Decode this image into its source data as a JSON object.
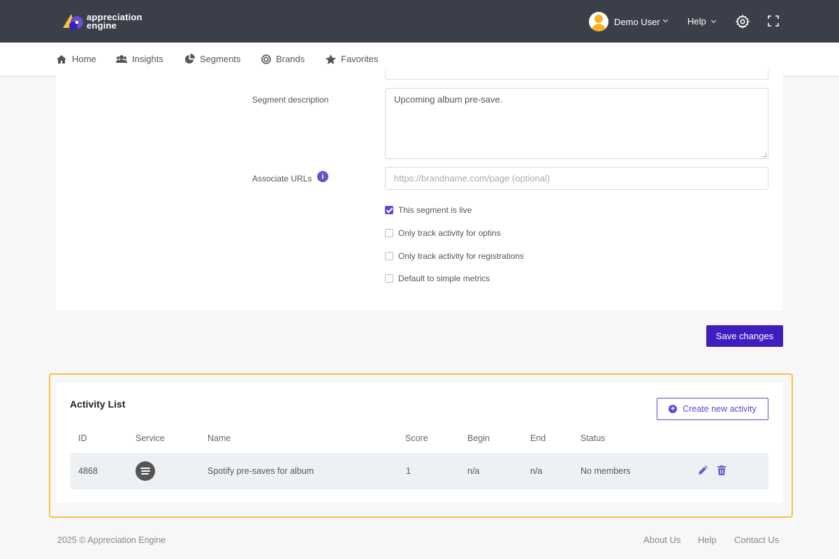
{
  "app": {
    "brand_line1": "appreciation",
    "brand_line2": "engine",
    "user_name": "Demo User",
    "help_label": "Help"
  },
  "nav": {
    "items": [
      {
        "label": "Home",
        "icon": "home-icon"
      },
      {
        "label": "Insights",
        "icon": "users-icon"
      },
      {
        "label": "Segments",
        "icon": "pie-chart-icon"
      },
      {
        "label": "Brands",
        "icon": "target-icon"
      },
      {
        "label": "Favorites",
        "icon": "star-icon"
      }
    ]
  },
  "form": {
    "description_label": "Segment description",
    "description_value": "Upcoming album pre-save.",
    "urls_label": "Associate URLs",
    "urls_placeholder": "https://brandname.com/page (optional)",
    "checkboxes": [
      {
        "label": "This segment is live",
        "checked": true
      },
      {
        "label": "Only track activity for optins",
        "checked": false
      },
      {
        "label": "Only track activity for registrations",
        "checked": false
      },
      {
        "label": "Default to simple metrics",
        "checked": false
      }
    ],
    "save_label": "Save changes"
  },
  "activity": {
    "title": "Activity List",
    "create_label": "Create new activity",
    "columns": [
      "ID",
      "Service",
      "Name",
      "Score",
      "Begin",
      "End",
      "Status"
    ],
    "rows": [
      {
        "id": "4868",
        "service": "spotify-icon",
        "name": "Spotify pre-saves for album",
        "score": "1",
        "begin": "n/a",
        "end": "n/a",
        "status": "No members"
      }
    ]
  },
  "footer": {
    "copyright": "2025 © Appreciation Engine",
    "links": [
      "About Us",
      "Help",
      "Contact Us"
    ]
  },
  "colors": {
    "topbar": "#3a3f4a",
    "primary": "#3d1fc0",
    "accent": "#5b4ad6",
    "highlight": "#f5c242"
  }
}
